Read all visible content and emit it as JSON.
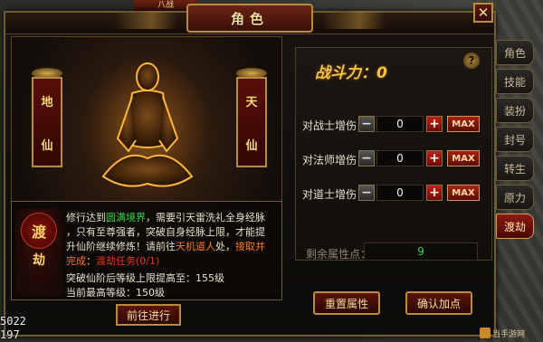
{
  "window": {
    "title": "角色",
    "close": "✕"
  },
  "top_fragment": "八战",
  "banners": {
    "left": [
      "地",
      "仙"
    ],
    "right": [
      "天",
      "仙"
    ]
  },
  "info": {
    "seal_main": "渡",
    "seal_sub": "劫",
    "line1_pre": "修行达到",
    "line1_hl": "圆满境界",
    "line1_post": "，需要引天雷洗礼全身经脉",
    "line2": "，只有至尊强者，突破自身经脉上限，才能提",
    "line3_pre": "升仙阶继续修炼！请前往",
    "line3_hl": "天机道人",
    "line3_mid": "处，",
    "line3_link": "接取并",
    "line4_link": "完成",
    "line4_sep": "：",
    "line4_quest": "渡劫任务(0/1)",
    "stat1": "突破仙阶后等级上限提高至：155级",
    "stat2": "当前最高等级：150级",
    "go_button": "前往进行"
  },
  "power": {
    "label": "战斗力：0",
    "help": "?"
  },
  "stats": [
    {
      "label": "对战士增伤",
      "minus": "−",
      "value": "0",
      "plus": "+",
      "max": "MAX"
    },
    {
      "label": "对法师增伤",
      "minus": "−",
      "value": "0",
      "plus": "+",
      "max": "MAX"
    },
    {
      "label": "对道士增伤",
      "minus": "−",
      "value": "0",
      "plus": "+",
      "max": "MAX"
    }
  ],
  "remaining": {
    "label": "剩余属性点：",
    "value": "9"
  },
  "buttons": {
    "reset": "重置属性",
    "confirm": "确认加点"
  },
  "side_tabs": [
    "角色",
    "技能",
    "装扮",
    "封号",
    "转生",
    "原力",
    "渡劫"
  ],
  "coords": {
    "line1": "5022",
    "line2": "197"
  },
  "watermark": "当手游网"
}
